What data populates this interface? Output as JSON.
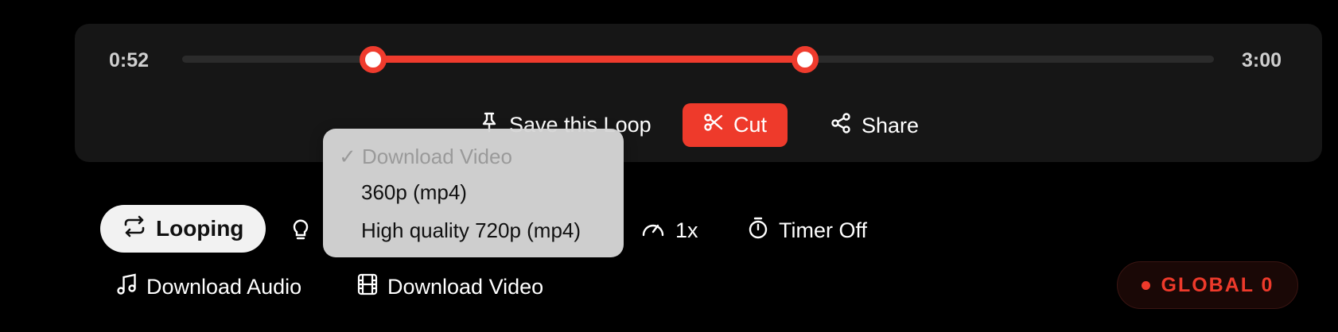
{
  "player": {
    "current_time": "0:52",
    "total_time": "3:00",
    "loop_start_fraction": 0.17,
    "loop_end_fraction": 0.59
  },
  "actions": {
    "save_loop": "Save this Loop",
    "cut": "Cut",
    "share": "Share"
  },
  "controls": {
    "looping": "Looping",
    "speed": "1x",
    "timer": "Timer Off",
    "download_audio": "Download Audio",
    "download_video": "Download Video"
  },
  "dropdown": {
    "header": "Download Video",
    "options": [
      "360p (mp4)",
      "High quality 720p (mp4)"
    ]
  },
  "badge": {
    "label": "GLOBAL 0"
  },
  "colors": {
    "accent": "#ee3a2b",
    "background": "#000000",
    "panel": "#161616"
  }
}
